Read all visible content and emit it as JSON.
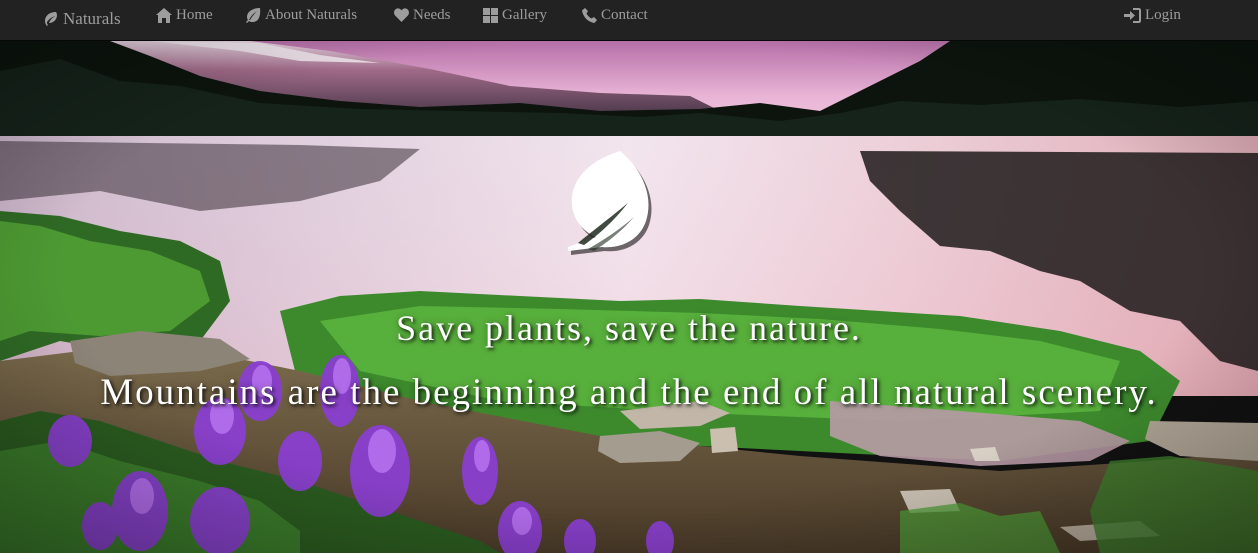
{
  "nav": {
    "brand": "Naturals",
    "items": [
      {
        "label": "Home",
        "icon": "home-icon"
      },
      {
        "label": "About Naturals",
        "icon": "leaf-icon"
      },
      {
        "label": "Needs",
        "icon": "heart-icon"
      },
      {
        "label": "Gallery",
        "icon": "grid-icon"
      },
      {
        "label": "Contact",
        "icon": "phone-icon"
      }
    ],
    "login": "Login"
  },
  "hero": {
    "line1": "Save plants, save the nature.",
    "line2": "Mountains are the beginning and the end of all natural scenery."
  },
  "colors": {
    "navbar_bg": "#222222",
    "nav_text": "#9d9d9d",
    "hero_text": "#ffffff"
  }
}
